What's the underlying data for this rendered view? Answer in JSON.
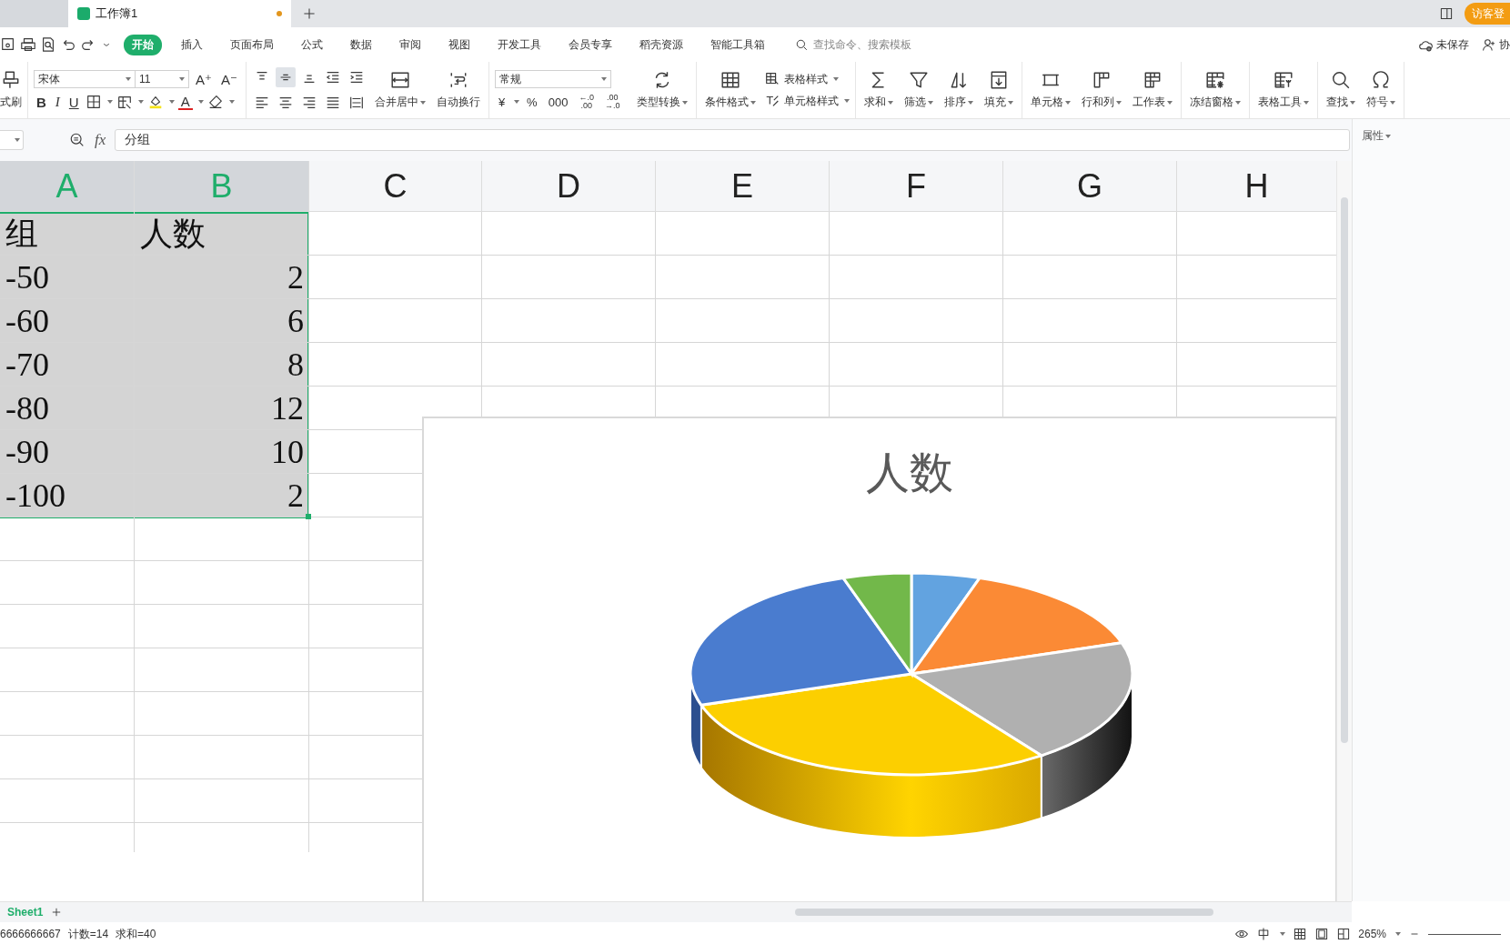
{
  "tabs": [
    {
      "selected": false,
      "modified": false
    },
    {
      "label": "工作簿1",
      "selected": true,
      "modified": true
    }
  ],
  "guest_button": "访客登",
  "menu": [
    {
      "label": "开始",
      "selected": true
    },
    {
      "label": "插入",
      "selected": false
    },
    {
      "label": "页面布局",
      "selected": false
    },
    {
      "label": "公式",
      "selected": false
    },
    {
      "label": "数据",
      "selected": false
    },
    {
      "label": "审阅",
      "selected": false
    },
    {
      "label": "视图",
      "selected": false
    },
    {
      "label": "开发工具",
      "selected": false
    },
    {
      "label": "会员专享",
      "selected": false
    },
    {
      "label": "稻壳资源",
      "selected": false
    },
    {
      "label": "智能工具箱",
      "selected": false
    }
  ],
  "search": {
    "placeholder": "查找命令、搜索模板"
  },
  "save_status": "未保存",
  "collab": "协",
  "ribbon": {
    "format_painter": "式刷",
    "font": {
      "family": "宋体",
      "size": "11",
      "size_buttons": [
        "A⁺",
        "A⁻"
      ],
      "style_buttons": [
        "B",
        "I",
        "U"
      ],
      "color_button": "A"
    },
    "align_tools": [
      {
        "selected": false
      },
      {
        "selected": true
      },
      {
        "selected": false
      },
      {
        "selected": false
      },
      {
        "selected": false
      },
      {
        "selected": false
      },
      {
        "selected": false
      },
      {
        "selected": false
      },
      {
        "selected": false
      },
      {
        "selected": false
      }
    ],
    "align_buttons": [
      {
        "label": "合并居中",
        "has_menu": true
      },
      {
        "label": "自动换行",
        "has_menu": false
      }
    ],
    "number": {
      "format": "常规",
      "buttons": [
        "¥",
        "%",
        "000",
        "←.0\n.00",
        ".00\n→.0"
      ]
    },
    "groups": [
      [
        {
          "kind": "large",
          "label": "类型转换",
          "has_menu": true
        }
      ],
      [
        {
          "kind": "large",
          "label": "条件格式",
          "has_menu": true
        },
        {
          "kind": "small",
          "label": "表格样式",
          "has_menu": true
        },
        {
          "kind": "small",
          "label": "单元格样式",
          "has_menu": true
        }
      ],
      [
        {
          "kind": "large",
          "label": "求和",
          "has_menu": true
        },
        {
          "kind": "large",
          "label": "筛选",
          "has_menu": true
        },
        {
          "kind": "large",
          "label": "排序",
          "has_menu": true
        },
        {
          "kind": "large",
          "label": "填充",
          "has_menu": true
        }
      ],
      [
        {
          "kind": "large",
          "label": "单元格",
          "has_menu": true
        },
        {
          "kind": "large",
          "label": "行和列",
          "has_menu": true
        },
        {
          "kind": "large",
          "label": "工作表",
          "has_menu": true
        }
      ],
      [
        {
          "kind": "large",
          "label": "冻结窗格",
          "has_menu": true
        }
      ],
      [
        {
          "kind": "large",
          "label": "表格工具",
          "has_menu": true
        }
      ],
      [
        {
          "kind": "large",
          "label": "查找",
          "has_menu": true
        },
        {
          "kind": "large",
          "label": "符号",
          "has_menu": true
        }
      ]
    ]
  },
  "formula_bar": {
    "fx": "fx",
    "value": "分组"
  },
  "panel": {
    "title": "属性"
  },
  "sheet": {
    "columns": [
      {
        "label": "A",
        "selected": true
      },
      {
        "label": "B",
        "selected": true
      },
      {
        "label": "C",
        "selected": false
      },
      {
        "label": "D",
        "selected": false
      },
      {
        "label": "E",
        "selected": false
      },
      {
        "label": "F",
        "selected": false
      },
      {
        "label": "G",
        "selected": false
      },
      {
        "label": "H",
        "selected": false
      }
    ],
    "header": [
      "组",
      "人数"
    ],
    "rows": [
      [
        "-50",
        "2"
      ],
      [
        "-60",
        "6"
      ],
      [
        "-70",
        "8"
      ],
      [
        "-80",
        "12"
      ],
      [
        "-90",
        "10"
      ],
      [
        "-100",
        "2"
      ]
    ]
  },
  "chart": {
    "title": "人数"
  },
  "sheet_tabs": [
    {
      "label": "Sheet1",
      "selected": true
    }
  ],
  "status_bar": {
    "items": [
      "6666666667",
      "计数=14",
      "求和=40"
    ],
    "zoom": "265%"
  }
}
